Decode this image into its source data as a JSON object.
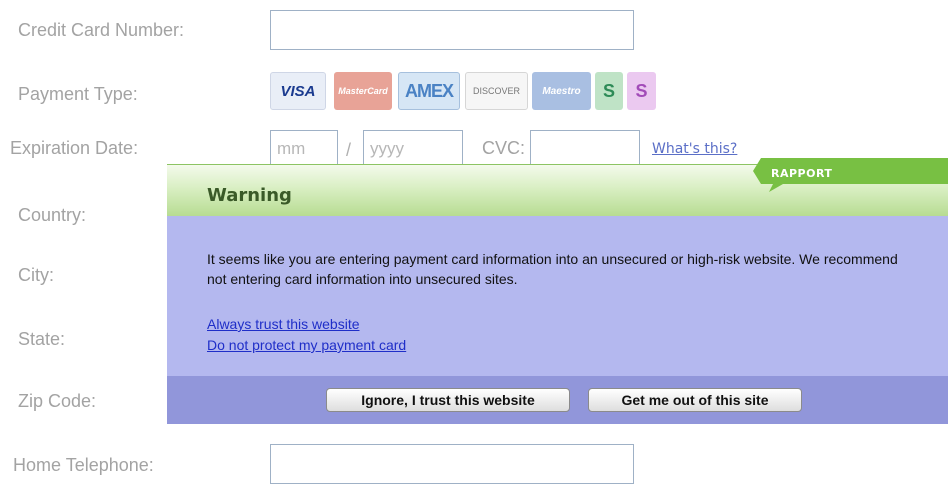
{
  "form": {
    "credit_card_label": "Credit Card Number:",
    "payment_type_label": "Payment Type:",
    "expiration_label": "Expiration Date:",
    "mm_placeholder": "mm",
    "slash": "/",
    "yyyy_placeholder": "yyyy",
    "cvc_label": "CVC:",
    "whats_this": "What's this?",
    "country_label": "Country:",
    "city_label": "City:",
    "state_label": "State:",
    "zip_label": "Zip Code:",
    "phone_label": "Home Telephone:"
  },
  "payment_cards": [
    {
      "name": "visa-icon",
      "label": "VISA"
    },
    {
      "name": "mastercard-icon",
      "label": "MasterCard"
    },
    {
      "name": "amex-icon",
      "label": "AMEX"
    },
    {
      "name": "discover-icon",
      "label": "DISCOVER"
    },
    {
      "name": "maestro-icon",
      "label": "Maestro"
    },
    {
      "name": "solo-icon",
      "label": "S"
    },
    {
      "name": "switch-icon",
      "label": "S"
    }
  ],
  "popup": {
    "brand": "RAPPORT",
    "title": "Warning",
    "message": "It seems like you are entering payment card information into an unsecured or high-risk website. We recommend not entering card information into unsecured sites.",
    "link_trust": "Always trust this website",
    "link_no_protect": "Do not protect my payment card",
    "btn_ignore": "Ignore, I trust this website",
    "btn_get_out": "Get me out of this site"
  },
  "colors": {
    "label_gray": "#a3a3a3",
    "field_border": "#9fb1c6",
    "popup_body": "#b4b8ef",
    "popup_footer": "#9196da",
    "header_green": "#b7dc92",
    "ribbon_green": "#78c043",
    "link_blue": "#1f2ec8"
  }
}
